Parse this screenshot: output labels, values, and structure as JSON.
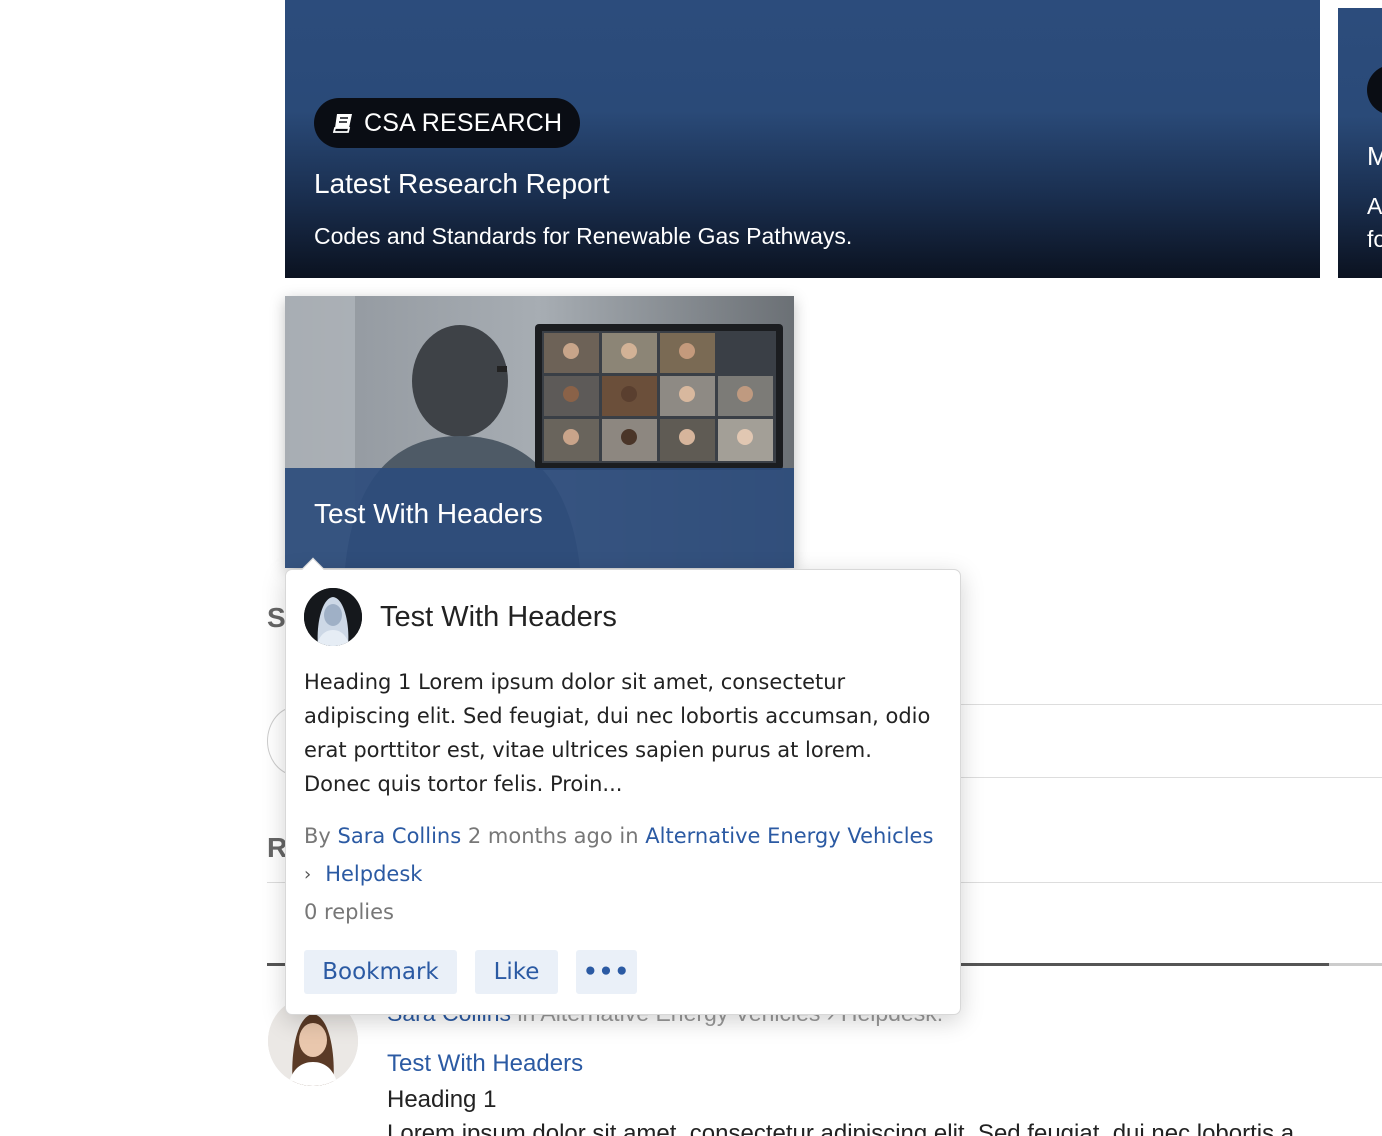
{
  "hero": {
    "badge": "CSA RESEARCH",
    "badge_icon": "book-icon",
    "title": "Latest Research Report",
    "description": "Codes and Standards for Renewable Gas Pathways."
  },
  "hero2": {
    "letter_m": "M",
    "letter_a": "A",
    "letter_fo": "fo"
  },
  "image_card": {
    "title": "Test With Headers"
  },
  "background": {
    "section_letter_s": "S",
    "section_letter_r": "R"
  },
  "popover": {
    "title": "Test With Headers",
    "body": "Heading 1 Lorem ipsum dolor sit amet, consectetur adipiscing elit. Sed feugiat, dui nec lobortis accumsan, odio erat porttitor est, vitae ultrices sapien purus at lorem. Donec quis tortor felis. Proin...",
    "by_label": "By",
    "author": "Sara Collins",
    "time": "2 months ago",
    "in_label": "in",
    "category": "Alternative Energy Vehicles",
    "subcategory": "Helpdesk",
    "replies": "0 replies",
    "bookmark_label": "Bookmark",
    "like_label": "Like",
    "more_label": "•••"
  },
  "feed": {
    "author": "Sara Collins",
    "meta": " in Alternative Energy Vehicles  ›  Helpdesk:",
    "title": "Test With Headers",
    "heading": "Heading 1",
    "body": "Lorem ipsum dolor sit amet, consectetur adipiscing elit. Sed feugiat, dui nec lobortis a"
  },
  "colors": {
    "link": "#2b5aa3",
    "hero_blue": "#2c4c7c",
    "button_bg": "#eaf0f8"
  }
}
